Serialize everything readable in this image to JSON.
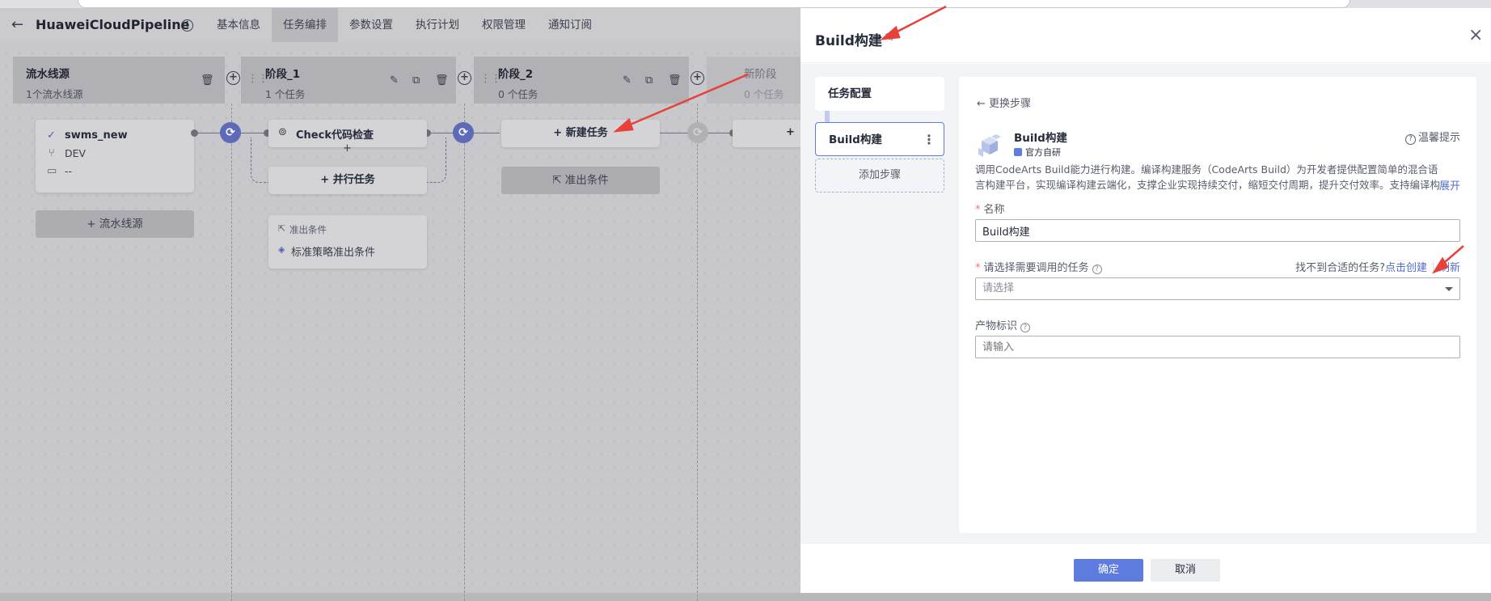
{
  "pipeline": {
    "title": "HuaweiCloudPipeline",
    "tabs": [
      "基本信息",
      "任务编排",
      "参数设置",
      "执行计划",
      "权限管理",
      "通知订阅"
    ],
    "active_tab": 1,
    "stages": [
      {
        "name": "流水线源",
        "sub": "1个流水线源"
      },
      {
        "name": "阶段_1",
        "sub": "1 个任务"
      },
      {
        "name": "阶段_2",
        "sub": "0 个任务"
      },
      {
        "name": "新阶段",
        "sub": "0 个任务"
      }
    ],
    "source_card": {
      "name": "swms_new",
      "branch": "DEV",
      "extra": "--"
    },
    "add_source_label": "+ 流水线源",
    "task_card": {
      "name": "Check代码检查"
    },
    "parallel_label": "+ 并行任务",
    "exit_condition": {
      "title": "准出条件",
      "item": "标准策略准出条件"
    },
    "new_task_label": "+ 新建任务",
    "exit_button_label": "准出条件"
  },
  "drawer": {
    "title": "Build构建",
    "side": {
      "config_label": "任务配置",
      "step_label": "Build构建",
      "add_step_label": "添加步骤"
    },
    "form": {
      "change_step": "更换步骤",
      "plugin_name": "Build构建",
      "official": "官方自研",
      "tip": "温馨提示",
      "description": "调用CodeArts Build能力进行构建。编译构建服务（CodeArts Build）为开发者提供配置简单的混合语言构建平台，实现编译构建云端化，支撑企业实现持续交付，缩短交付周期，提升交付效率。支持编译构建...",
      "expand": "展开",
      "name_label": "名称",
      "name_value": "Build构建",
      "task_label": "请选择需要调用的任务",
      "task_placeholder": "请选择",
      "nofind_text": "找不到合适的任务?",
      "create_link": "点击创建",
      "refresh_link": "刷新",
      "artifact_label": "产物标识",
      "artifact_placeholder": "请输入"
    },
    "footer": {
      "confirm": "确定",
      "cancel": "取消"
    }
  },
  "colors": {
    "primary": "#5e7ce0",
    "link": "#526ecc",
    "annotation": "#e8413a",
    "mask": "#b9b9bd"
  }
}
